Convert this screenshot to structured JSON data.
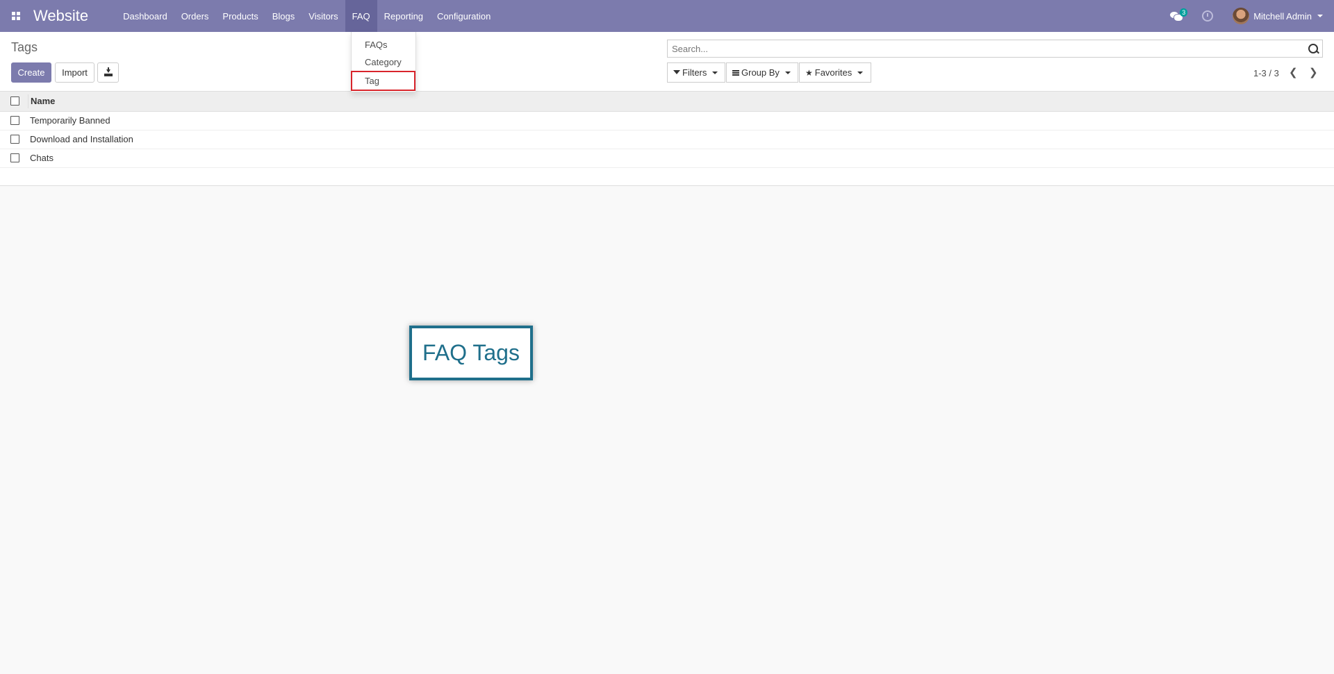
{
  "navbar": {
    "app_name": "Website",
    "menu": [
      "Dashboard",
      "Orders",
      "Products",
      "Blogs",
      "Visitors",
      "FAQ",
      "Reporting",
      "Configuration"
    ],
    "active_menu": "FAQ",
    "messages_count": "3",
    "user_name": "Mitchell Admin",
    "icons": [
      "apps-icon",
      "chat-icon",
      "clock-icon",
      "avatar"
    ]
  },
  "faq_dropdown": {
    "items": [
      "FAQs",
      "Category",
      "Tag"
    ],
    "highlighted": "Tag",
    "highlight_color": "#d8242b"
  },
  "control_panel": {
    "breadcrumb": "Tags",
    "create_label": "Create",
    "import_label": "Import",
    "search_placeholder": "Search...",
    "filters_label": "Filters",
    "groupby_label": "Group By",
    "favorites_label": "Favorites",
    "pager": "1-3 / 3"
  },
  "table": {
    "columns": [
      "Name"
    ],
    "rows": [
      "Temporarily Banned",
      "Download and Installation",
      "Chats"
    ]
  },
  "annotation": {
    "label": "FAQ Tags",
    "color": "#1f6f8b"
  },
  "colors": {
    "brand": "#7c7bad",
    "active_menu_bg": "#66659a"
  }
}
